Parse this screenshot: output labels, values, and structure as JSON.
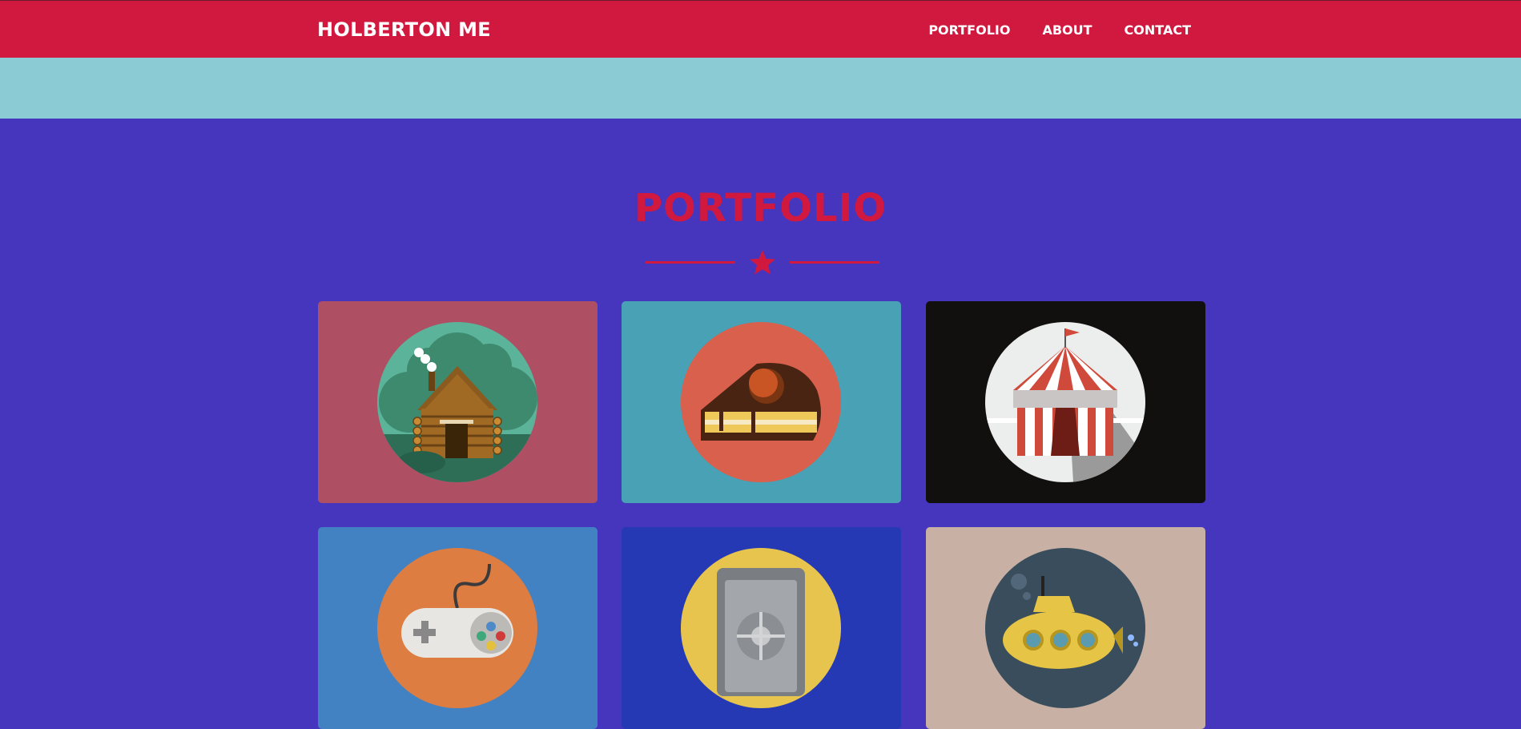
{
  "nav": {
    "brand": "HOLBERTON ME",
    "links": [
      "PORTFOLIO",
      "ABOUT",
      "CONTACT"
    ]
  },
  "portfolio": {
    "title": "PORTFOLIO",
    "divider_icon": "star-icon",
    "items": [
      {
        "icon": "log-cabin-icon",
        "bg": "#ae4f64"
      },
      {
        "icon": "cake-slice-icon",
        "bg": "#48a1b5"
      },
      {
        "icon": "circus-tent-icon",
        "bg": "#11100e"
      },
      {
        "icon": "game-controller-icon",
        "bg": "#4382c2"
      },
      {
        "icon": "safe-icon",
        "bg": "#2539b5"
      },
      {
        "icon": "submarine-icon",
        "bg": "#c8b1a4"
      }
    ]
  },
  "colors": {
    "navbar": "#d1183f",
    "band": "#8bcbd3",
    "page": "#4636be",
    "accent": "#d1183f"
  }
}
